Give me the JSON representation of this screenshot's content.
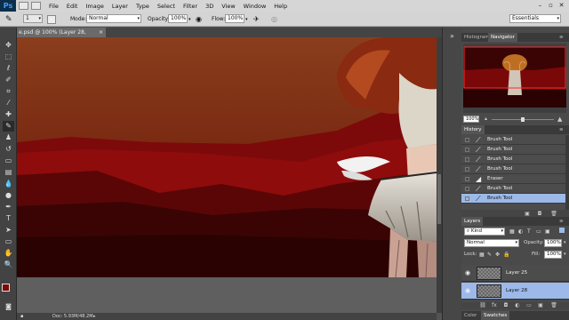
{
  "app": {
    "logo": "Ps"
  },
  "menu": [
    "File",
    "Edit",
    "Image",
    "Layer",
    "Type",
    "Select",
    "Filter",
    "3D",
    "View",
    "Window",
    "Help"
  ],
  "options": {
    "mode_label": "Mode:",
    "mode_value": "Normal",
    "opacity_label": "Opacity:",
    "opacity_value": "100%",
    "flow_label": "Flow:",
    "flow_value": "100%",
    "brush_size": "1",
    "workspace": "Essentials"
  },
  "document": {
    "tab_title": "e.psd @ 100% (Layer 28, RGB/8#) *",
    "status": "Doc: 5.93M/48.2M"
  },
  "navigator": {
    "tabs": [
      "Histogram",
      "Navigator"
    ],
    "active_tab": "Navigator",
    "zoom": "100%"
  },
  "history": {
    "title": "History",
    "items": [
      {
        "label": "Brush Tool",
        "selected": false
      },
      {
        "label": "Brush Tool",
        "selected": false
      },
      {
        "label": "Brush Tool",
        "selected": false
      },
      {
        "label": "Brush Tool",
        "selected": false
      },
      {
        "label": "Eraser",
        "selected": false
      },
      {
        "label": "Brush Tool",
        "selected": false
      },
      {
        "label": "Brush Tool",
        "selected": true
      }
    ]
  },
  "layers": {
    "title": "Layers",
    "filter_kind": "Kind",
    "blend_mode": "Normal",
    "opacity_label": "Opacity:",
    "opacity_value": "100%",
    "lock_label": "Lock:",
    "fill_label": "Fill:",
    "fill_value": "100%",
    "items": [
      {
        "name": "Layer 25",
        "selected": false
      },
      {
        "name": "Layer 28",
        "selected": true
      }
    ]
  },
  "bottom_tabs": [
    "Color",
    "Swatches"
  ],
  "colors": {
    "foreground": "#7a0a0a",
    "background": "#ffffff",
    "selection": "#9cb9e9"
  }
}
